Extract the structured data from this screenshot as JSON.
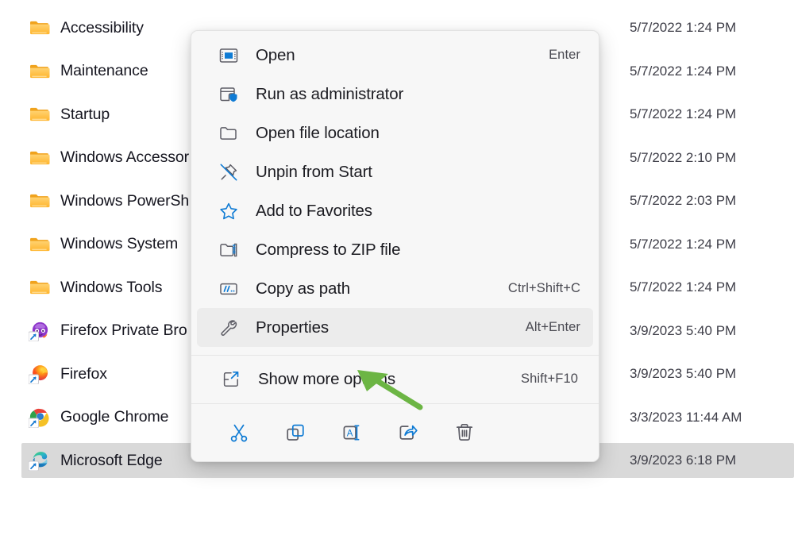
{
  "file_list": {
    "rows": [
      {
        "name": "Accessibility",
        "icon": "folder-icon",
        "date": "5/7/2022 1:24 PM",
        "selected": false
      },
      {
        "name": "Maintenance",
        "icon": "folder-icon",
        "date": "5/7/2022 1:24 PM",
        "selected": false
      },
      {
        "name": "Startup",
        "icon": "folder-icon",
        "date": "5/7/2022 1:24 PM",
        "selected": false
      },
      {
        "name": "Windows Accessor",
        "icon": "folder-icon",
        "date": "5/7/2022 2:10 PM",
        "selected": false
      },
      {
        "name": "Windows PowerSh",
        "icon": "folder-icon",
        "date": "5/7/2022 2:03 PM",
        "selected": false
      },
      {
        "name": "Windows System",
        "icon": "folder-icon",
        "date": "5/7/2022 1:24 PM",
        "selected": false
      },
      {
        "name": "Windows Tools",
        "icon": "folder-icon",
        "date": "5/7/2022 1:24 PM",
        "selected": false
      },
      {
        "name": "Firefox Private Bro",
        "icon": "firefox-private-browsing-icon",
        "date": "3/9/2023 5:40 PM",
        "selected": false
      },
      {
        "name": "Firefox",
        "icon": "firefox-icon",
        "date": "3/9/2023 5:40 PM",
        "selected": false
      },
      {
        "name": "Google Chrome",
        "icon": "google-chrome-icon",
        "date": "3/3/2023 11:44 AM",
        "selected": false
      },
      {
        "name": "Microsoft Edge",
        "icon": "microsoft-edge-icon",
        "date": "3/9/2023 6:18 PM",
        "selected": true
      }
    ]
  },
  "context_menu": {
    "items": [
      {
        "label": "Open",
        "accel": "Enter",
        "icon": "open-window-icon",
        "hover": false
      },
      {
        "label": "Run as administrator",
        "accel": "",
        "icon": "shield-window-icon",
        "hover": false
      },
      {
        "label": "Open file location",
        "accel": "",
        "icon": "folder-outline-icon",
        "hover": false
      },
      {
        "label": "Unpin from Start",
        "accel": "",
        "icon": "unpin-icon",
        "hover": false
      },
      {
        "label": "Add to Favorites",
        "accel": "",
        "icon": "star-icon",
        "hover": false
      },
      {
        "label": "Compress to ZIP file",
        "accel": "",
        "icon": "zip-folder-icon",
        "hover": false
      },
      {
        "label": "Copy as path",
        "accel": "Ctrl+Shift+C",
        "icon": "copy-as-path-icon",
        "hover": false
      },
      {
        "label": "Properties",
        "accel": "Alt+Enter",
        "icon": "wrench-icon",
        "hover": true
      }
    ],
    "footer_items": [
      {
        "label": "Show more options",
        "accel": "Shift+F10",
        "icon": "show-more-options-icon",
        "hover": false
      }
    ],
    "action_bar": [
      {
        "name": "cut-button",
        "icon": "scissors-icon",
        "tooltip": "Cut"
      },
      {
        "name": "copy-button",
        "icon": "copy-icon",
        "tooltip": "Copy"
      },
      {
        "name": "rename-button",
        "icon": "rename-icon",
        "tooltip": "Rename"
      },
      {
        "name": "share-button",
        "icon": "share-icon",
        "tooltip": "Share"
      },
      {
        "name": "delete-button",
        "icon": "trash-icon",
        "tooltip": "Delete"
      }
    ]
  },
  "annotation": {
    "arrow_color": "#6CB544",
    "points_at": "Properties"
  },
  "colors": {
    "menu_background": "#f7f7f7",
    "menu_hover": "#ececec",
    "row_selected": "#d9d9d9",
    "accent_blue": "#0f7bd4",
    "folder_yellow": "#ffc24b",
    "text_primary": "#1c1c22",
    "text_secondary": "#4a4a52",
    "icon_outline": "#5d5d66"
  }
}
